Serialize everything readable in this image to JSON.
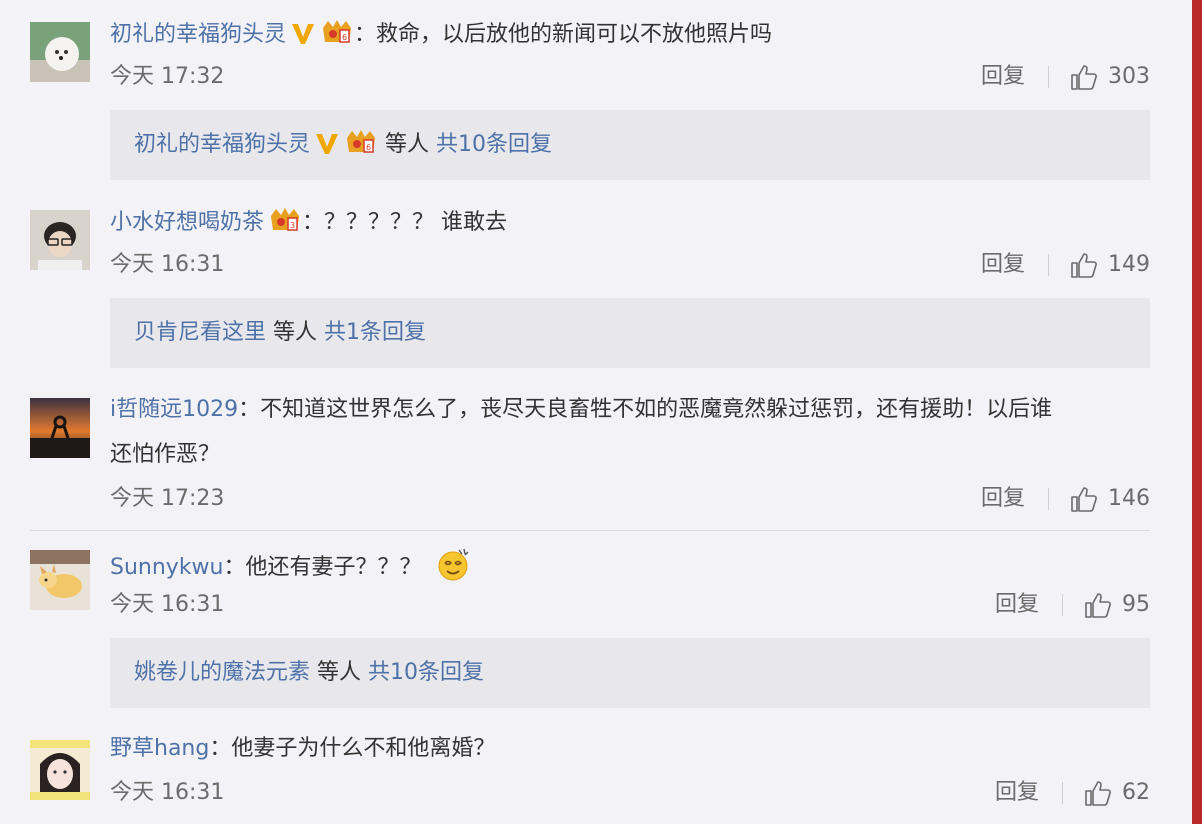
{
  "comments": [
    {
      "username": "初礼的幸福狗头灵",
      "colon": "：",
      "text": "救命，以后放他的新闻可以不放他照片吗",
      "time": "今天 17:32",
      "reply": "回复",
      "likes": "303",
      "sub": {
        "name": "初礼的幸福狗头灵",
        "etc": "等人",
        "total": "共10条回复"
      }
    },
    {
      "username": "小水好想喝奶茶",
      "colon": "：",
      "text": "？？？？？ 谁敢去",
      "time": "今天 16:31",
      "reply": "回复",
      "likes": "149",
      "sub": {
        "name": "贝肯尼看这里",
        "etc": "等人",
        "total": "共1条回复"
      }
    },
    {
      "username": "i哲随远1029",
      "colon": "：",
      "text": "不知道这世界怎么了，丧尽天良畜牲不如的恶魔竟然躲过惩罚，还有援助！以后谁",
      "text2": "还怕作恶？",
      "time": "今天 17:23",
      "reply": "回复",
      "likes": "146"
    },
    {
      "username": "Sunnykwu",
      "colon": "：",
      "text": "他还有妻子？？？",
      "time": "今天 16:31",
      "reply": "回复",
      "likes": "95",
      "sub": {
        "name": "姚卷儿的魔法元素",
        "etc": "等人",
        "total": "共10条回复"
      }
    },
    {
      "username": "野草hang",
      "colon": "：",
      "text": "他妻子为什么不和他离婚？",
      "time": "今天 16:31",
      "reply": "回复",
      "likes": "62"
    }
  ],
  "colors": {
    "background": "#f3f2f6",
    "username": "#4e72a8",
    "accent_bar": "#b82929",
    "verified": "#f0a800",
    "crown": "#e8a020"
  },
  "icons": [
    "verified-v-icon",
    "vip-crown-icon",
    "thumbs-up-icon",
    "emoji-dizzy-icon"
  ]
}
